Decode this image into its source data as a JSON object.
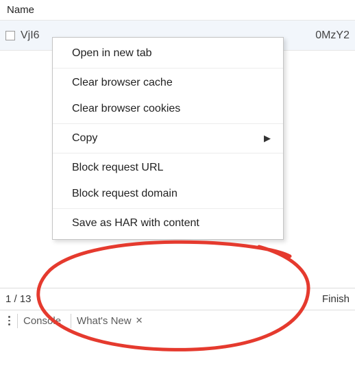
{
  "header": {
    "name_label": "Name"
  },
  "row": {
    "filename_left": "VjI6",
    "filename_right": "0MzY2"
  },
  "context_menu": {
    "open_new_tab": "Open in new tab",
    "clear_cache": "Clear browser cache",
    "clear_cookies": "Clear browser cookies",
    "copy": "Copy",
    "block_url": "Block request URL",
    "block_domain": "Block request domain",
    "save_har": "Save as HAR with content"
  },
  "status": {
    "left": "1 / 13",
    "right": "Finish"
  },
  "bottom_tabs": {
    "console": "Console",
    "whats_new": "What's New"
  }
}
